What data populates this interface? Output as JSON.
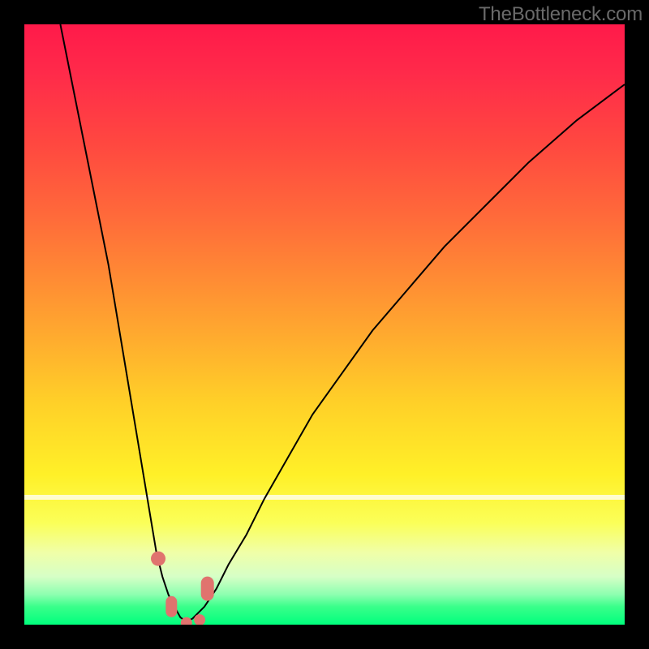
{
  "watermark": "TheBottleneck.com",
  "chart_data": {
    "type": "line",
    "title": "",
    "xlabel": "",
    "ylabel": "",
    "xlim": [
      0,
      100
    ],
    "ylim": [
      0,
      100
    ],
    "grid": false,
    "legend": false,
    "series": [
      {
        "name": "left-branch",
        "x": [
          6,
          8,
          10,
          12,
          14,
          16,
          17,
          18,
          19,
          20,
          21,
          22,
          23,
          24,
          25,
          26,
          27
        ],
        "y": [
          100,
          90,
          80,
          70,
          60,
          48,
          42,
          36,
          30,
          24,
          18,
          12,
          8,
          5,
          3,
          1.2,
          0.5
        ]
      },
      {
        "name": "right-branch",
        "x": [
          27,
          28,
          30,
          32,
          34,
          37,
          40,
          44,
          48,
          53,
          58,
          64,
          70,
          77,
          84,
          92,
          100
        ],
        "y": [
          0.5,
          1,
          3,
          6,
          10,
          15,
          21,
          28,
          35,
          42,
          49,
          56,
          63,
          70,
          77,
          84,
          90
        ]
      }
    ],
    "markers": [
      {
        "name": "left-dot",
        "x": 22.3,
        "y": 11,
        "r": 9
      },
      {
        "name": "left-pill",
        "x": 24.5,
        "y": 3,
        "w": 14,
        "h": 26
      },
      {
        "name": "right-pill",
        "x": 30.5,
        "y": 6,
        "w": 16,
        "h": 30
      },
      {
        "name": "base-dot-a",
        "x": 27,
        "y": 0.3,
        "r": 7
      },
      {
        "name": "base-dot-b",
        "x": 29.2,
        "y": 0.8,
        "r": 7
      }
    ],
    "background_gradient": {
      "top": "#ff1a4a",
      "mid": "#ffd028",
      "bottom": "#00ff7d"
    }
  }
}
